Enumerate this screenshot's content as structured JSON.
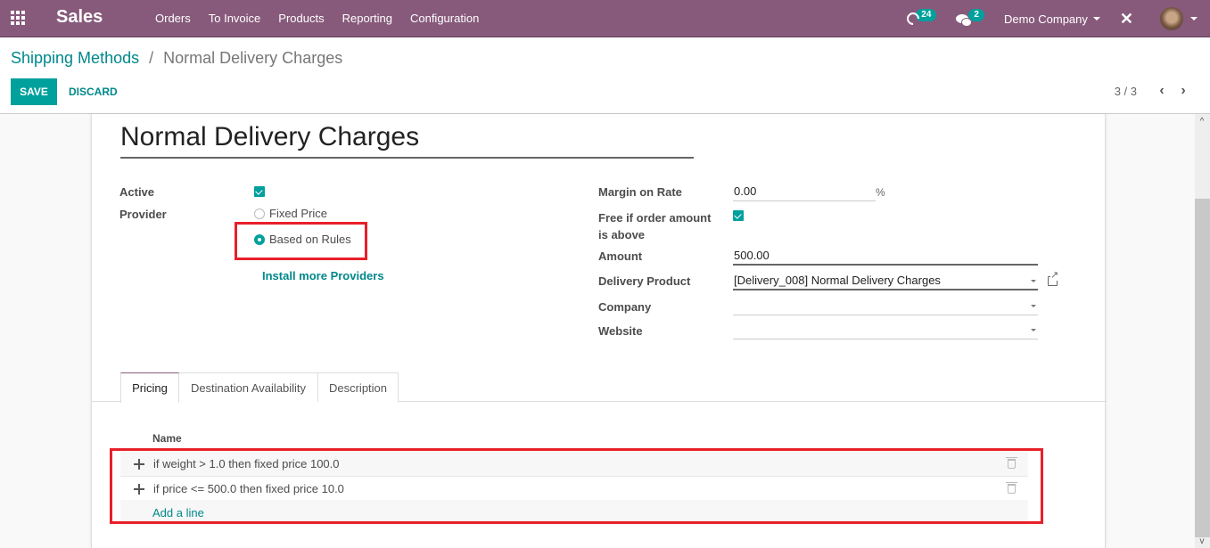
{
  "navbar": {
    "app_name": "Sales",
    "menu": [
      "Orders",
      "To Invoice",
      "Products",
      "Reporting",
      "Configuration"
    ],
    "activity_count": "24",
    "messages_count": "2",
    "company": "Demo Company"
  },
  "breadcrumb": {
    "parent": "Shipping Methods",
    "separator": "/",
    "current": "Normal Delivery Charges"
  },
  "toolbar": {
    "save_label": "SAVE",
    "discard_label": "DISCARD"
  },
  "pager": {
    "value": "3 / 3"
  },
  "form": {
    "name": "Normal Delivery Charges",
    "active_label": "Active",
    "active": true,
    "provider_label": "Provider",
    "provider_options": [
      "Fixed Price",
      "Based on Rules"
    ],
    "provider_selected": "Based on Rules",
    "install_more_label": "Install more Providers",
    "margin_label": "Margin on Rate",
    "margin_value": "0.00",
    "margin_suffix": "%",
    "free_label": "Free if order amount is above",
    "free_checked": true,
    "amount_label": "Amount",
    "amount_value": "500.00",
    "delivery_product_label": "Delivery Product",
    "delivery_product_value": "[Delivery_008] Normal Delivery Charges",
    "company_label": "Company",
    "company_value": "",
    "website_label": "Website",
    "website_value": ""
  },
  "tabs": [
    {
      "label": "Pricing",
      "active": true
    },
    {
      "label": "Destination Availability",
      "active": false
    },
    {
      "label": "Description",
      "active": false
    }
  ],
  "pricing_table": {
    "column": "Name",
    "rows": [
      "if weight > 1.0 then fixed price 100.0",
      "if price <= 500.0 then fixed price 10.0"
    ],
    "add_line_label": "Add a line"
  },
  "highlight_color": "#e8202a",
  "accent_color": "#00a09d",
  "navbar_color": "#875a7b"
}
